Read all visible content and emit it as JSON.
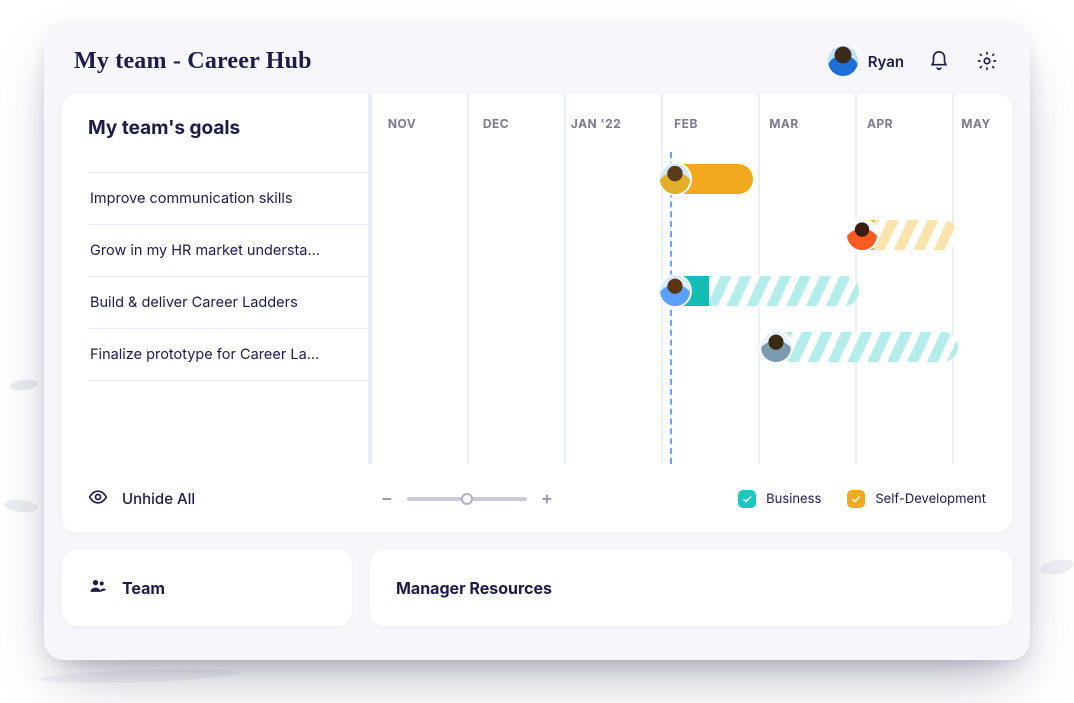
{
  "header": {
    "title": "My team - Career Hub",
    "user_name": "Ryan"
  },
  "goals": {
    "panel_title": "My team's goals",
    "items": [
      {
        "label": "Improve communication skills"
      },
      {
        "label": "Grow in my HR market understa..."
      },
      {
        "label": "Build & deliver Career Ladders"
      },
      {
        "label": "Finalize prototype for Career La..."
      }
    ]
  },
  "timeline": {
    "months": [
      "NOV",
      "DEC",
      "JAN '22",
      "FEB",
      "MAR",
      "APR",
      "MAY"
    ]
  },
  "controls": {
    "unhide_label": "Unhide All",
    "legend": {
      "business": "Business",
      "self_dev": "Self-Development"
    },
    "zoom_minus": "−",
    "zoom_plus": "+"
  },
  "bottom": {
    "team_label": "Team",
    "resources_label": "Manager Resources"
  },
  "chart_data": {
    "type": "gantt",
    "x_axis": {
      "months": [
        "NOV",
        "DEC",
        "JAN '22",
        "FEB",
        "MAR",
        "APR",
        "MAY"
      ],
      "today": "FEB"
    },
    "legend": [
      {
        "name": "Business",
        "color": "#17c9c0"
      },
      {
        "name": "Self-Development",
        "color": "#f2a81f"
      }
    ],
    "rows": [
      {
        "goal": "Improve communication skills",
        "category": "Self-Development",
        "start": "FEB",
        "end": "FEB",
        "progress_pct": 100
      },
      {
        "goal": "Grow in my HR market understanding",
        "category": "Self-Development",
        "start": "APR",
        "end": "MAY",
        "progress_pct": 20
      },
      {
        "goal": "Build & deliver Career Ladders",
        "category": "Business",
        "start": "FEB",
        "end": "MAR",
        "progress_pct": 25
      },
      {
        "goal": "Finalize prototype for Career Ladders",
        "category": "Business",
        "start": "MAR",
        "end": "MAY",
        "progress_pct": 0
      }
    ]
  }
}
